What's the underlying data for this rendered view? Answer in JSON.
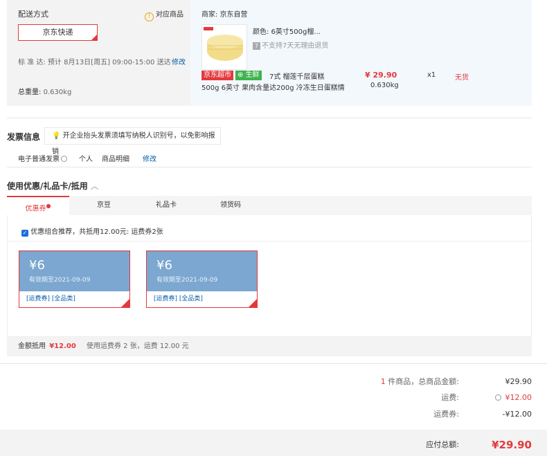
{
  "shipping": {
    "title": "配送方式",
    "related_products": "对应商品",
    "express_option": "京东快递",
    "standard_label": "标 准 达:",
    "eta": "预计 8月13日[周五] 09:00-15:00 送达",
    "modify": "修改",
    "total_weight_label": "总重量:",
    "total_weight": "0.630kg"
  },
  "merchant": {
    "label": "商家: 京东自营",
    "spec": "颜色: 6英寸500g榴...",
    "no_return": "不支持7天无理由退货",
    "tag_jd": "京东超市",
    "tag_fresh": "生鲜",
    "product_name_1": "7式 榴莲千层蛋糕",
    "product_name_2": "500g 6英寸 果肉含量达200g 冷冻生日蛋糕情",
    "price": "¥ 29.90",
    "weight": "0.630kg",
    "qty": "x1",
    "stock": "无货"
  },
  "invoice": {
    "title": "发票信息",
    "tooltip": "开企业抬头发票须填写纳税人识别号，以免影响报销",
    "type": "电子普通发票",
    "holder": "个人",
    "content": "商品明细",
    "modify": "修改"
  },
  "coupons": {
    "title": "使用优惠/礼品卡/抵用",
    "tabs": [
      "优惠券",
      "京豆",
      "礼品卡",
      "领货码"
    ],
    "recommend": "优惠组合推荐，共抵用12.00元: 运费券2张",
    "items": [
      {
        "amount": "¥6",
        "expiry": "有效期至2021-09-09",
        "tags": "[运费券]  [全品类]"
      },
      {
        "amount": "¥6",
        "expiry": "有效期至2021-09-09",
        "tags": "[运费券]  [全品类]"
      }
    ],
    "deduct_label": "金额抵用",
    "deduct_amount": "¥12.00",
    "deduct_desc": "使用运费券 2 张，运费 12.00 元"
  },
  "summary": {
    "items_count": "1",
    "items_label": "件商品，总商品金额:",
    "items_total": "¥29.90",
    "shipping_label": "运费:",
    "shipping_fee": "¥12.00",
    "coupon_label": "运费券:",
    "coupon_value": "-¥12.00",
    "payable_label": "应付总额:",
    "payable": "¥29.90"
  },
  "colors": {
    "accent": "#e4393c",
    "link": "#005ea7",
    "coupon": "#7ba7d0"
  }
}
